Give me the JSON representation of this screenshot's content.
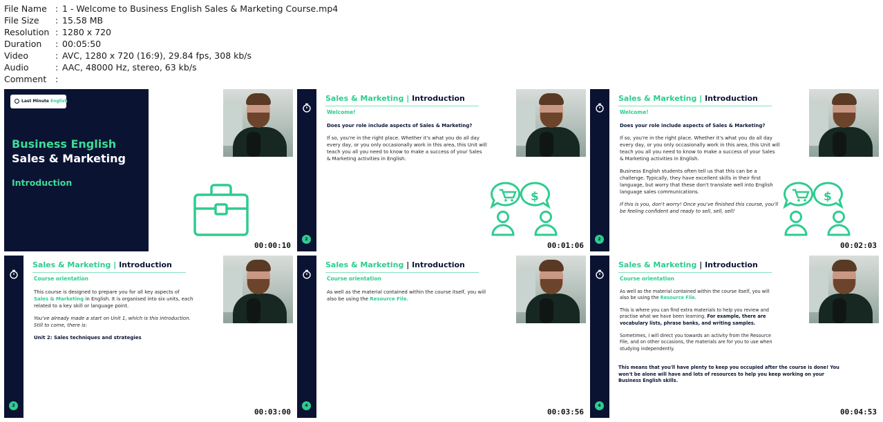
{
  "info": {
    "file_name": {
      "key": "File Name",
      "value": "1 - Welcome to Business English Sales & Marketing Course.mp4"
    },
    "file_size": {
      "key": "File Size",
      "value": "15.58 MB"
    },
    "resolution": {
      "key": "Resolution",
      "value": "1280 x 720"
    },
    "duration": {
      "key": "Duration",
      "value": "00:05:50"
    },
    "video": {
      "key": "Video",
      "value": "AVC, 1280 x 720 (16:9), 29.84 fps, 308 kb/s"
    },
    "audio": {
      "key": "Audio",
      "value": "AAC, 48000 Hz, stereo, 63 kb/s"
    },
    "comment": {
      "key": "Comment",
      "value": ""
    },
    "separator": ":"
  },
  "colors": {
    "navy": "#0b1333",
    "green": "#2ecc8f"
  },
  "thumbs": [
    {
      "timestamp": "00:00:10",
      "logo": {
        "left": "Last Minute",
        "right": "English"
      },
      "title_line1": "Business English",
      "title_line2": "Sales & Marketing",
      "title_line3": "Introduction",
      "icon": "briefcase-icon"
    },
    {
      "timestamp": "00:01:06",
      "slide_number": "2",
      "header_green": "Sales & Marketing |",
      "header_navy": "Introduction",
      "heading": "Welcome!",
      "question": "Does your role include aspects of Sales & Marketing?",
      "para1": "If so, you're in the right place. Whether it's what you do all day every day, or you only occasionally work in this area, this Unit will teach you all you need to know to make a success of your Sales & Marketing activities in English.",
      "icon": "sales-chat-people-icon"
    },
    {
      "timestamp": "00:02:03",
      "slide_number": "2",
      "header_green": "Sales & Marketing |",
      "header_navy": "Introduction",
      "heading": "Welcome!",
      "question": "Does your role include aspects of Sales & Marketing?",
      "para1": "If so, you're in the right place. Whether it's what you do all day every day, or you only occasionally work in this area, this Unit will teach you all you need to know to make a success of your Sales & Marketing activities in English.",
      "para2": "Business English students often tell us that this can be a challenge. Typically, they have excellent skills in their first language, but worry that these don't translate well into English language sales communications.",
      "para3": "If this is you, don't worry! Once you've finished this course, you'll be feeling confident and ready to sell, sell, sell!",
      "icon": "sales-chat-people-icon"
    },
    {
      "timestamp": "00:03:00",
      "slide_number": "3",
      "header_green": "Sales & Marketing |",
      "header_navy": "Introduction",
      "heading": "Course orientation",
      "para1_a": "This course is designed to prepare you for all key aspects of",
      "para1_hl": "Sales & Marketing",
      "para1_b": "in English. It is organised into six units, each related to a key skill or language point.",
      "para2": "You've already made a start on Unit 1, which is this introduction. Still to come, there is:",
      "para3": "Unit 2: Sales techniques and strategies"
    },
    {
      "timestamp": "00:03:56",
      "slide_number": "4",
      "header_green": "Sales & Marketing",
      "header_navy": "| Introduction",
      "heading": "Course orientation",
      "para1_a": "As well as the material contained within the course itself, you will also be using the",
      "para1_hl": "Resource File",
      "para1_b": "."
    },
    {
      "timestamp": "00:04:53",
      "slide_number": "4",
      "header_green": "Sales & Marketing",
      "header_navy": "| Introduction",
      "heading": "Course orientation",
      "para1_a": "As well as the material contained within the course itself, you will also be using the",
      "para1_hl": "Resource File",
      "para1_b": ".",
      "para2_a": "This is where you can find extra materials to help you review and practise what we have been learning.",
      "para2_bold": "For example, there are vocabulary lists, phrase banks, and writing samples.",
      "para3": "Sometimes, I will direct you towards an activity from the Resource File, and on other occasions, the materials are for you to use when studying independently.",
      "para4": "This means that you'll have plenty to keep you occupied after the course is done! You won't be alone will have and  lots of resources to help you keep working on your Business English skills."
    }
  ]
}
